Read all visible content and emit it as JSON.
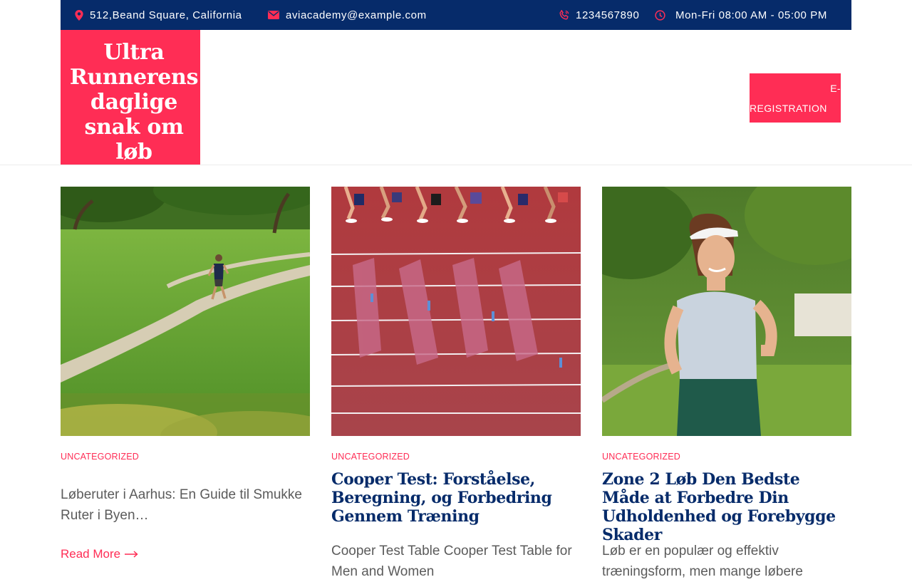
{
  "topbar": {
    "address": "512,Beand Square, California",
    "email": "aviacademy@example.com",
    "phone": "1234567890",
    "hours": "Mon-Fri 08:00 AM - 05:00 PM"
  },
  "header": {
    "site_title": "Ultra Runnerens daglige snak om løb",
    "cta_line1": "E-",
    "cta_line2": "REGISTRATION"
  },
  "posts": [
    {
      "category": "UNCATEGORIZED",
      "title": "",
      "excerpt": "Løberuter i Aarhus: En Guide til Smukke Ruter i Byen…",
      "read_more": "Read More"
    },
    {
      "category": "UNCATEGORIZED",
      "title": "Cooper Test: Forståelse, Beregning, og Forbedring Gennem Træning",
      "excerpt": "Cooper Test Table Cooper Test Table for Men and Women",
      "read_more": ""
    },
    {
      "category": "UNCATEGORIZED",
      "title": "Zone 2 Løb Den Bedste Måde at Forbedre Din Udholdenhed og Forebygge Skader",
      "excerpt": "Løb er en populær og effektiv træningsform, men mange løbere",
      "read_more": ""
    }
  ],
  "colors": {
    "topbar_bg": "#062b6a",
    "accent": "#ff2d55",
    "title": "#062b6a"
  },
  "icons": {
    "address": "map-marker-icon",
    "email": "envelope-icon",
    "phone": "phone-icon",
    "hours": "clock-icon",
    "read_more": "arrow-right-icon"
  }
}
